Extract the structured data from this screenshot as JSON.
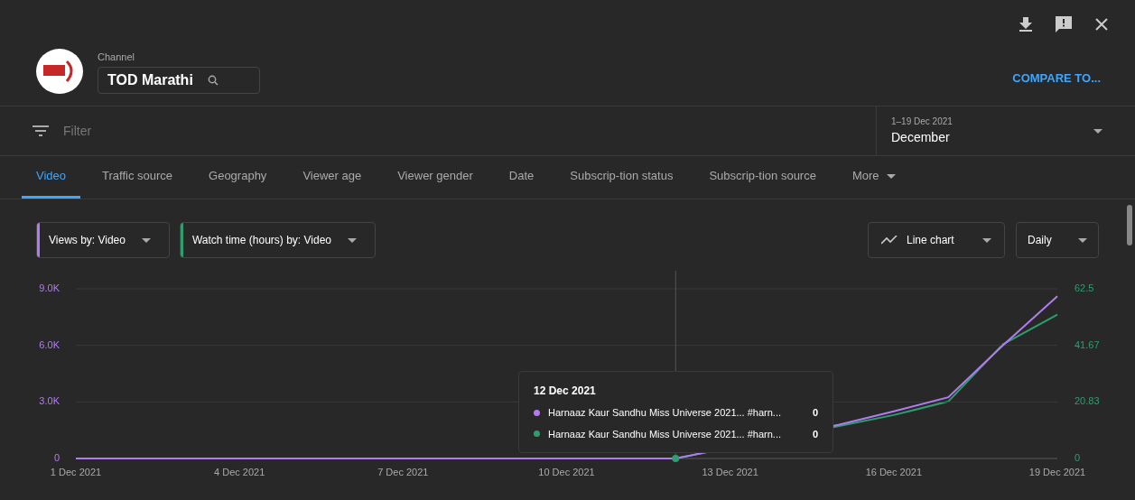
{
  "channel": {
    "label": "Channel",
    "name": "TOD Marathi"
  },
  "compare_link": "COMPARE TO...",
  "filter": {
    "placeholder": "Filter"
  },
  "date_range": {
    "range": "1–19 Dec 2021",
    "period": "December"
  },
  "tabs": [
    {
      "label": "Video",
      "selected": true
    },
    {
      "label": "Traffic source",
      "selected": false
    },
    {
      "label": "Geography",
      "selected": false
    },
    {
      "label": "Viewer age",
      "selected": false
    },
    {
      "label": "Viewer gender",
      "selected": false
    },
    {
      "label": "Date",
      "selected": false
    },
    {
      "label": "Subscrip-tion status",
      "selected": false
    },
    {
      "label": "Subscrip-tion source",
      "selected": false
    },
    {
      "label": "More",
      "selected": false
    }
  ],
  "metric_selectors": [
    {
      "label": "Views by: Video",
      "color": "#b27cf0"
    },
    {
      "label": "Watch time (hours) by: Video",
      "color": "#2e9e6e"
    }
  ],
  "chart_type": "Line chart",
  "interval": "Daily",
  "charts": [
    {
      "chart_data": {
        "type": "line",
        "categories": [
          "1 Dec 2021",
          null,
          null,
          "4 Dec 2021",
          null,
          null,
          "7 Dec 2021",
          null,
          null,
          "10 Dec 2021",
          null,
          null,
          "13 Dec 2021",
          null,
          null,
          "16 Dec 2021",
          null,
          null,
          "19 Dec 2021"
        ],
        "ylim": [
          0,
          9000
        ],
        "yticks": [
          {
            "value": 0,
            "label": "0"
          },
          {
            "value": 3000,
            "label": "3.0K"
          },
          {
            "value": 6000,
            "label": "6.0K"
          },
          {
            "value": 9000,
            "label": "9.0K"
          }
        ],
        "series": [
          {
            "color": "#b27cf0",
            "values": [
              0,
              0,
              0,
              0,
              0,
              0,
              0,
              0,
              0,
              0,
              0,
              0,
              null,
              null,
              1800,
              2500,
              3250,
              6000,
              8600
            ]
          }
        ]
      }
    },
    {
      "chart_data": {
        "type": "line",
        "categories": [
          null,
          null,
          null,
          null,
          null,
          null,
          null,
          null,
          null,
          null,
          null,
          null,
          null,
          null,
          null,
          null,
          null,
          null,
          null
        ],
        "ylim": [
          0,
          62.5
        ],
        "yticks": [
          {
            "value": 0,
            "label": "0"
          },
          {
            "value": 20.83,
            "label": "20.83"
          },
          {
            "value": 41.67,
            "label": "41.67"
          },
          {
            "value": 62.5,
            "label": "62.5"
          }
        ],
        "series": [
          {
            "color": "#2e9e6e",
            "values": [
              null,
              null,
              null,
              null,
              null,
              null,
              null,
              null,
              null,
              null,
              null,
              0,
              null,
              null,
              12,
              16,
              21,
              42,
              53
            ]
          }
        ]
      }
    }
  ],
  "tooltip": {
    "date": "12 Dec 2021",
    "rows": [
      {
        "label": "Harnaaz Kaur Sandhu Miss Universe 2021... #harn...",
        "value": "0",
        "color": "#b27cf0"
      },
      {
        "label": "Harnaaz Kaur Sandhu Miss Universe 2021... #harn...",
        "value": "0",
        "color": "#2e9e6e"
      }
    ]
  }
}
